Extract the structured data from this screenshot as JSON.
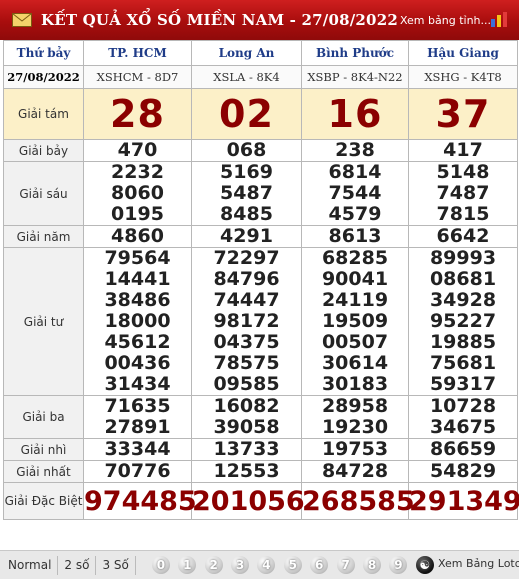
{
  "header": {
    "title": "KẾT QUẢ XỔ SỐ MIỀN NAM - 27/08/2022",
    "table_link": "Xem bảng tỉnh..."
  },
  "columns": {
    "day": "Thứ bảy",
    "date": "27/08/2022",
    "provinces": [
      {
        "name": "TP. HCM",
        "code": "XSHCM - 8D7"
      },
      {
        "name": "Long An",
        "code": "XSLA - 8K4"
      },
      {
        "name": "Bình Phước",
        "code": "XSBP - 8K4-N22"
      },
      {
        "name": "Hậu Giang",
        "code": "XSHG - K4T8"
      }
    ]
  },
  "prizes": [
    {
      "label": "Giải tám",
      "values": [
        [
          "28"
        ],
        [
          "02"
        ],
        [
          "16"
        ],
        [
          "37"
        ]
      ]
    },
    {
      "label": "Giải bảy",
      "values": [
        [
          "470"
        ],
        [
          "068"
        ],
        [
          "238"
        ],
        [
          "417"
        ]
      ]
    },
    {
      "label": "Giải sáu",
      "values": [
        [
          "2232",
          "8060",
          "0195"
        ],
        [
          "5169",
          "5487",
          "8485"
        ],
        [
          "6814",
          "7544",
          "4579"
        ],
        [
          "5148",
          "7487",
          "7815"
        ]
      ]
    },
    {
      "label": "Giải năm",
      "values": [
        [
          "4860"
        ],
        [
          "4291"
        ],
        [
          "8613"
        ],
        [
          "6642"
        ]
      ]
    },
    {
      "label": "Giải tư",
      "values": [
        [
          "79564",
          "14441",
          "38486",
          "18000",
          "45612",
          "00436",
          "31434"
        ],
        [
          "72297",
          "84796",
          "74447",
          "98172",
          "04375",
          "78575",
          "09585"
        ],
        [
          "68285",
          "90041",
          "24119",
          "19509",
          "00507",
          "30614",
          "30183"
        ],
        [
          "89993",
          "08681",
          "34928",
          "95227",
          "19885",
          "75681",
          "59317"
        ]
      ]
    },
    {
      "label": "Giải ba",
      "values": [
        [
          "71635",
          "27891"
        ],
        [
          "16082",
          "39058"
        ],
        [
          "28958",
          "19230"
        ],
        [
          "10728",
          "34675"
        ]
      ]
    },
    {
      "label": "Giải nhì",
      "values": [
        [
          "33344"
        ],
        [
          "13733"
        ],
        [
          "19753"
        ],
        [
          "86659"
        ]
      ]
    },
    {
      "label": "Giải nhất",
      "values": [
        [
          "70776"
        ],
        [
          "12553"
        ],
        [
          "84728"
        ],
        [
          "54829"
        ]
      ]
    },
    {
      "label": "Giải Đặc Biệt",
      "values": [
        [
          "974485"
        ],
        [
          "201056"
        ],
        [
          "268585"
        ],
        [
          "291349"
        ]
      ]
    }
  ],
  "footer": {
    "modes": [
      "Normal",
      "2 số",
      "3 Số"
    ],
    "digits": [
      "0",
      "1",
      "2",
      "3",
      "4",
      "5",
      "6",
      "7",
      "8",
      "9"
    ],
    "loto_link": "Xem Bảng Loto"
  },
  "colors": {
    "header_red": "#b51414",
    "number_dark_red": "#8b0000",
    "highlight_yellow": "#fcf0c8",
    "province_blue": "#1f3c88"
  }
}
